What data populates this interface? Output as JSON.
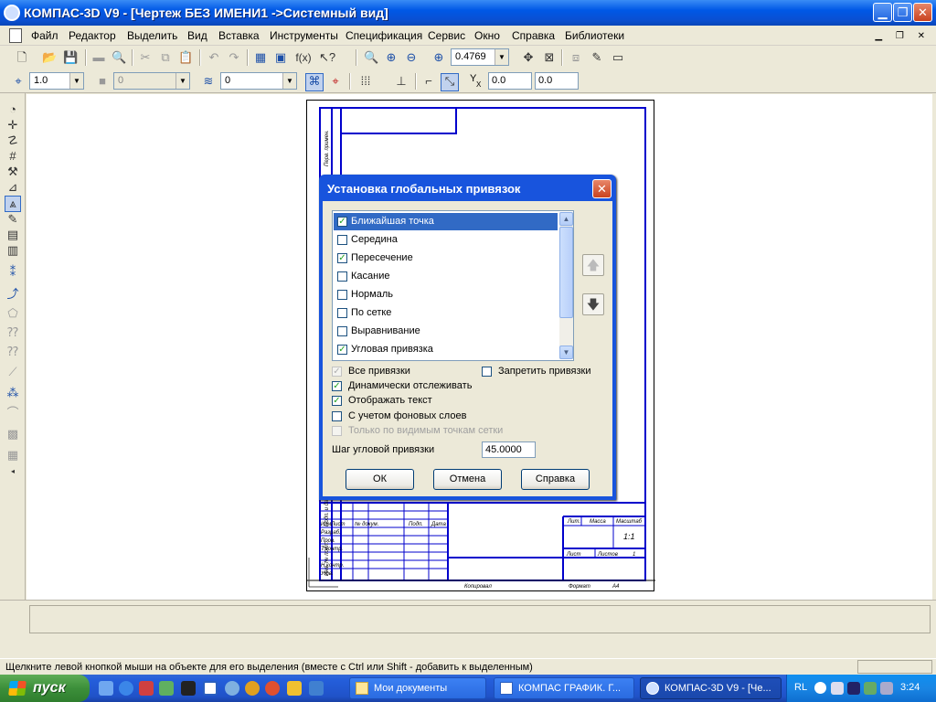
{
  "window": {
    "title": "КОМПАС-3D V9 - [Чертеж БЕЗ ИМЕНИ1 ->Системный вид]",
    "min_glyph": "▁",
    "max_glyph": "❐",
    "close_glyph": "✕"
  },
  "menu": {
    "items": [
      "Файл",
      "Редактор",
      "Выделить",
      "Вид",
      "Вставка",
      "Инструменты",
      "Спецификация",
      "Сервис",
      "Окно",
      "Справка",
      "Библиотеки"
    ],
    "mdi_controls": "▁ ❐ ✕"
  },
  "toolbar": {
    "zoom_value": "0.4769",
    "linestyle_value": "1.0",
    "layer_color_value": "0",
    "layer_value": "0",
    "coord_label": "Y",
    "coord_sub": "X",
    "coord_x": "0.0",
    "coord_y": "0.0",
    "fx_label": "f(x)"
  },
  "dialog": {
    "title": "Установка глобальных привязок",
    "close_glyph": "✕",
    "check_glyph": "✓",
    "snaps": [
      {
        "label": "Ближайшая точка",
        "checked": true,
        "selected": true
      },
      {
        "label": "Середина",
        "checked": false,
        "selected": false
      },
      {
        "label": "Пересечение",
        "checked": true,
        "selected": false
      },
      {
        "label": "Касание",
        "checked": false,
        "selected": false
      },
      {
        "label": "Нормаль",
        "checked": false,
        "selected": false
      },
      {
        "label": "По сетке",
        "checked": false,
        "selected": false
      },
      {
        "label": "Выравнивание",
        "checked": false,
        "selected": false
      },
      {
        "label": "Угловая привязка",
        "checked": true,
        "selected": false
      }
    ],
    "options": {
      "all_snaps": {
        "label": "Все привязки",
        "checked": true,
        "disabled": true
      },
      "forbid_snaps": {
        "label": "Запретить привязки",
        "checked": false,
        "disabled": false
      },
      "dynamic_tracking": {
        "label": "Динамически отслеживать",
        "checked": true,
        "disabled": false
      },
      "show_text": {
        "label": "Отображать текст",
        "checked": true,
        "disabled": false
      },
      "background_layers": {
        "label": "С учетом фоновых слоев",
        "checked": false,
        "disabled": false
      },
      "visible_grid_only": {
        "label": "Только по видимым точкам сетки",
        "checked": false,
        "disabled": true
      }
    },
    "angle_step_label": "Шаг угловой привязки",
    "angle_step_value": "45.0000",
    "buttons": {
      "ok": "ОК",
      "cancel": "Отмена",
      "help": "Справка"
    },
    "up_glyph": "🡅",
    "down_glyph": "🡇"
  },
  "drawing": {
    "stamp_col_labels": [
      "Изм.",
      "Лист",
      "№ докум.",
      "Подп.",
      "Дата"
    ],
    "stamp_row_labels": [
      "Разраб.",
      "Пров.",
      "Т.контр.",
      "Н.контр.",
      "Утв."
    ],
    "lit_label": "Лит.",
    "mass_label": "Масса",
    "scale_label": "Масштаб",
    "scale_value": "1:1",
    "sheet_label": "Лист",
    "sheets_label": "Листов",
    "sheets_value": "1",
    "copied_label": "Копировал",
    "format_label": "Формат",
    "format_value": "А4",
    "side_labels": [
      "Перв. примен.",
      "Подп. и дата",
      "Инв. № подл."
    ]
  },
  "status": {
    "text": "Щелкните левой кнопкой мыши на объекте для его выделения (вместе с Ctrl или Shift - добавить к выделенным)"
  },
  "taskbar": {
    "start_label": "пуск",
    "tasks": [
      {
        "label": "Мои документы",
        "active": false
      },
      {
        "label": "КОМПАС ГРАФИК. Г...",
        "active": false
      },
      {
        "label": "КОМПАС-3D V9 - [Че...",
        "active": true
      }
    ],
    "lang": "RL",
    "clock": "3:24"
  },
  "colors": {
    "title_blue": "#0058e6",
    "dialog_blue": "#1854dd",
    "selection": "#316ac5",
    "drawing_frame": "#0000cc"
  }
}
